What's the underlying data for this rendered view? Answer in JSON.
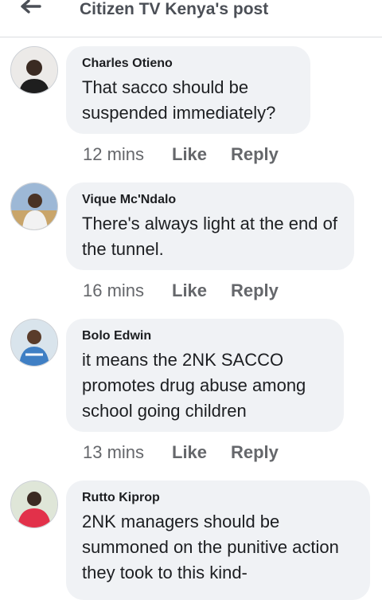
{
  "header": {
    "title": "Citizen TV Kenya's post"
  },
  "comments": [
    {
      "author": "Charles Otieno",
      "text": "That sacco should be suspended immediately?",
      "time": "12 mins",
      "like": "Like",
      "reply": "Reply"
    },
    {
      "author": "Vique Mc'Ndalo",
      "text": "There's always light at the end of the tunnel.",
      "time": "16 mins",
      "like": "Like",
      "reply": "Reply"
    },
    {
      "author": "Bolo Edwin",
      "text": "it means the 2NK SACCO promotes drug abuse among school going children",
      "time": "13 mins",
      "like": "Like",
      "reply": "Reply"
    },
    {
      "author": "Rutto Kiprop",
      "text": "2NK managers should be summoned on the punitive action they took to this kind-"
    }
  ]
}
